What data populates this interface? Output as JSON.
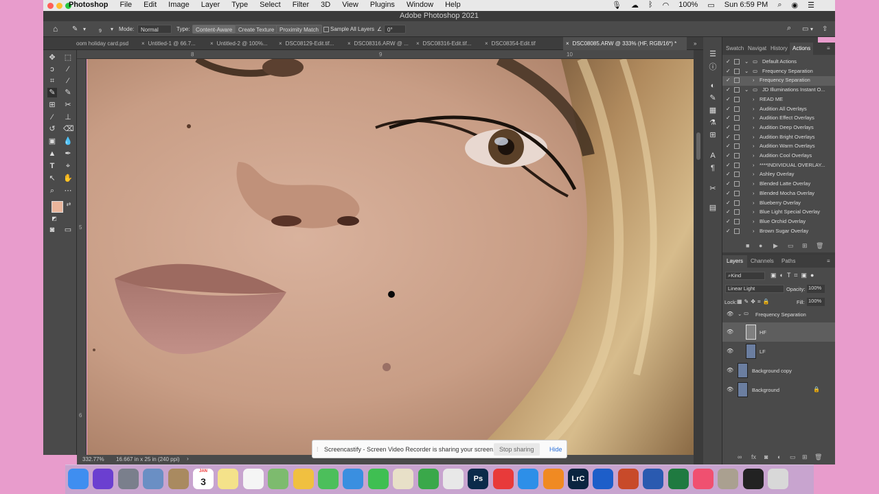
{
  "menubar": {
    "app": "Photoshop",
    "items": [
      "File",
      "Edit",
      "Image",
      "Layer",
      "Type",
      "Select",
      "Filter",
      "3D",
      "View",
      "Plugins",
      "Window",
      "Help"
    ],
    "battery": "100%",
    "clock": "Sun 6:59 PM"
  },
  "window": {
    "title": "Adobe Photoshop 2021"
  },
  "options": {
    "brush_size": "9",
    "mode_label": "Mode:",
    "mode_value": "Normal",
    "type_label": "Type:",
    "type_content_aware": "Content-Aware",
    "type_create_texture": "Create Texture",
    "type_proximity": "Proximity Match",
    "sample_all": "Sample All Layers",
    "angle": "0°"
  },
  "tabs": [
    "oom holiday card.psd",
    "Untitled-1 @ 66.7...",
    "Untitled-2 @ 100%...",
    "DSC08129-Edit.tif...",
    "DSC08316.ARW @ ...",
    "DSC08316-Edit.tif...",
    "DSC08354-Edit.tif",
    "DSC08085.ARW @ 333% (HF, RGB/16*) *"
  ],
  "ruler": {
    "top": [
      "8",
      "9",
      "10"
    ],
    "left": [
      "5",
      "6"
    ]
  },
  "status": {
    "zoom": "332.77%",
    "doc": "16.667 in x 25 in (240 ppi)"
  },
  "actions_panel": {
    "tabs": [
      "Swatch",
      "Navigat",
      "History",
      "Actions"
    ],
    "rows": [
      {
        "label": "Default Actions",
        "folder": true,
        "indent": 0
      },
      {
        "label": "Frequency Separation",
        "folder": true,
        "indent": 0
      },
      {
        "label": "Frequency Separation",
        "folder": false,
        "indent": 1,
        "selected": true
      },
      {
        "label": "JD Illuminations Instant O...",
        "folder": true,
        "indent": 0
      },
      {
        "label": "READ ME",
        "folder": false,
        "indent": 1
      },
      {
        "label": "Audition All Overlays",
        "folder": false,
        "indent": 1
      },
      {
        "label": "Audition Effect Overlays",
        "folder": false,
        "indent": 1
      },
      {
        "label": "Audition Deep Overlays",
        "folder": false,
        "indent": 1
      },
      {
        "label": "Audition Bright Overlays",
        "folder": false,
        "indent": 1
      },
      {
        "label": "Audition Warm Overlays",
        "folder": false,
        "indent": 1
      },
      {
        "label": "Audition Cool Overlays",
        "folder": false,
        "indent": 1
      },
      {
        "label": "****INDIVIDUAL OVERLAY...",
        "folder": false,
        "indent": 1
      },
      {
        "label": "Ashley Overlay",
        "folder": false,
        "indent": 1
      },
      {
        "label": "Blended Latte Overlay",
        "folder": false,
        "indent": 1
      },
      {
        "label": "Blended Mocha Overlay",
        "folder": false,
        "indent": 1
      },
      {
        "label": "Blueberry Overlay",
        "folder": false,
        "indent": 1
      },
      {
        "label": "Blue Light Special Overlay",
        "folder": false,
        "indent": 1
      },
      {
        "label": "Blue Orchid Overlay",
        "folder": false,
        "indent": 1
      },
      {
        "label": "Brown Sugar Overlay",
        "folder": false,
        "indent": 1
      }
    ]
  },
  "layers_panel": {
    "tabs": [
      "Layers",
      "Channels",
      "Paths"
    ],
    "kind": "Kind",
    "blend": "Linear Light",
    "opacity_label": "Opacity:",
    "opacity": "100%",
    "lock_label": "Lock:",
    "fill_label": "Fill:",
    "fill": "100%",
    "group": "Frequency Separation",
    "layers": [
      "HF",
      "LF",
      "Background copy",
      "Background"
    ]
  },
  "toast": {
    "message": "Screencastify - Screen Video Recorder is sharing your screen.",
    "stop": "Stop sharing",
    "hide": "Hide"
  },
  "dock": {
    "calendar_day": "3",
    "calendar_month": "JAN",
    "apps": [
      {
        "name": "Finder",
        "label": "",
        "color": "#3f8ef0"
      },
      {
        "name": "Siri",
        "label": "",
        "color": "#6b3fd0"
      },
      {
        "name": "Launchpad",
        "label": "",
        "color": "#7a7f8c"
      },
      {
        "name": "Preview",
        "label": "",
        "color": "#6a8fc4"
      },
      {
        "name": "Contacts",
        "label": "",
        "color": "#a98a60"
      },
      {
        "name": "Calendar",
        "label": "",
        "color": "#ffffff"
      },
      {
        "name": "Notes",
        "label": "",
        "color": "#f4e28a"
      },
      {
        "name": "Reminders",
        "label": "",
        "color": "#f5f5f5"
      },
      {
        "name": "Maps",
        "label": "",
        "color": "#7dbb6e"
      },
      {
        "name": "Photos",
        "label": "",
        "color": "#f0c040"
      },
      {
        "name": "Messages",
        "label": "",
        "color": "#4cbf5b"
      },
      {
        "name": "Safari",
        "label": "",
        "color": "#3a8fe0"
      },
      {
        "name": "FaceTime",
        "label": "",
        "color": "#3fbf52"
      },
      {
        "name": "TextEdit",
        "label": "",
        "color": "#e8e0c8"
      },
      {
        "name": "Numbers",
        "label": "",
        "color": "#3aa84a"
      },
      {
        "name": "Chrome",
        "label": "",
        "color": "#e8e8e8"
      },
      {
        "name": "Photoshop",
        "label": "Ps",
        "color": "#0b2a4a"
      },
      {
        "name": "News",
        "label": "",
        "color": "#e83a3a"
      },
      {
        "name": "App Store",
        "label": "",
        "color": "#2d8fe8"
      },
      {
        "name": "Books",
        "label": "",
        "color": "#f08a22"
      },
      {
        "name": "Lightroom Classic",
        "label": "LrC",
        "color": "#0a2540"
      },
      {
        "name": "Dropbox",
        "label": "",
        "color": "#1d5ec9"
      },
      {
        "name": "PowerPoint",
        "label": "",
        "color": "#c84a2a"
      },
      {
        "name": "Word",
        "label": "",
        "color": "#2a5ab0"
      },
      {
        "name": "Excel",
        "label": "",
        "color": "#1f7a40"
      },
      {
        "name": "Music",
        "label": "",
        "color": "#f05070"
      },
      {
        "name": "Font Book",
        "label": "",
        "color": "#aaa090"
      },
      {
        "name": "Screenshot",
        "label": "",
        "color": "#222222"
      },
      {
        "name": "Trash",
        "label": "",
        "color": "#d8d8d8"
      }
    ]
  },
  "colors": {
    "foreground": "#e9b59b",
    "background": "#ffffff",
    "accent": "#2a6fd8"
  }
}
